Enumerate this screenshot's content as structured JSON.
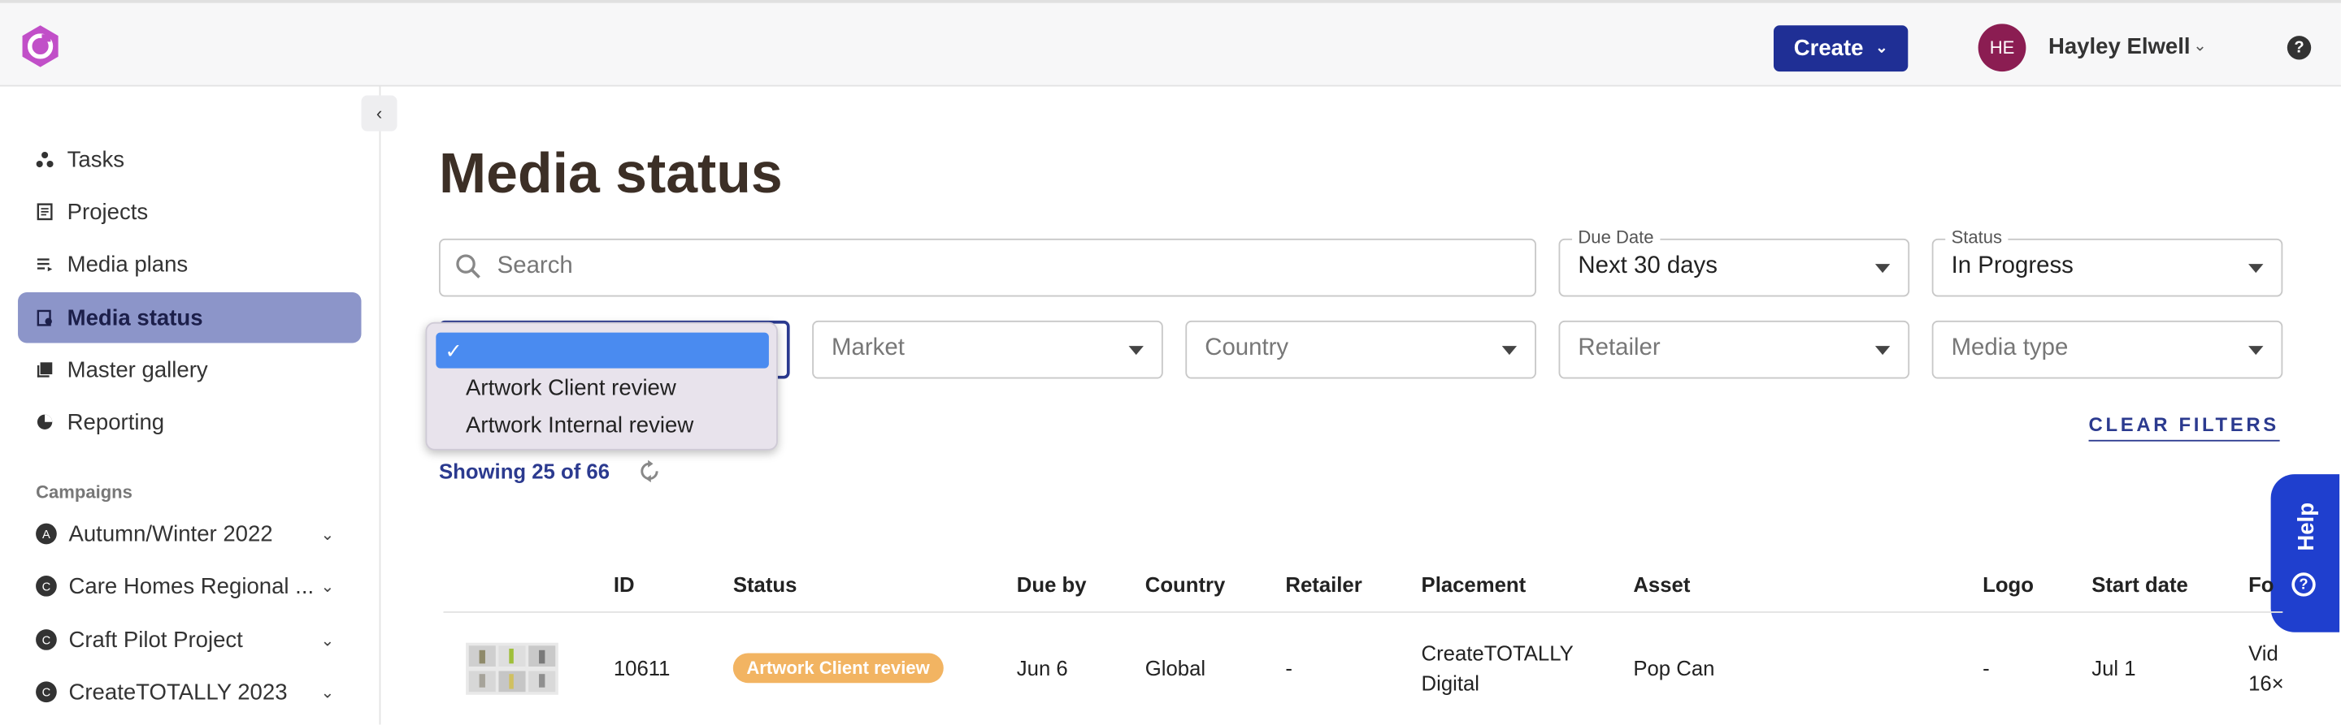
{
  "header": {
    "create_label": "Create",
    "user_initials": "HE",
    "user_name": "Hayley Elwell",
    "help_symbol": "?"
  },
  "sidebar": {
    "items": [
      {
        "label": "Tasks",
        "icon": "tasks-icon"
      },
      {
        "label": "Projects",
        "icon": "projects-icon"
      },
      {
        "label": "Media plans",
        "icon": "media-plans-icon"
      },
      {
        "label": "Media status",
        "icon": "media-status-icon",
        "active": true
      },
      {
        "label": "Master gallery",
        "icon": "gallery-icon"
      },
      {
        "label": "Reporting",
        "icon": "reporting-icon"
      }
    ],
    "campaigns_label": "Campaigns",
    "campaigns": [
      {
        "badge": "A",
        "label": "Autumn/Winter 2022"
      },
      {
        "badge": "C",
        "label": "Care Homes Regional ..."
      },
      {
        "badge": "C",
        "label": "Craft Pilot Project"
      },
      {
        "badge": "C",
        "label": "CreateTOTALLY 2023"
      }
    ]
  },
  "main": {
    "title": "Media status",
    "search_placeholder": "Search",
    "due_date": {
      "legend": "Due Date",
      "value": "Next 30 days"
    },
    "status": {
      "legend": "Status",
      "value": "In Progress"
    },
    "filters": {
      "market": "Market",
      "country": "Country",
      "retailer": "Retailer",
      "media_type": "Media type"
    },
    "dropdown": {
      "selected_mark": "✓",
      "options": [
        "Artwork Client review",
        "Artwork Internal review"
      ]
    },
    "clear_filters": "CLEAR FILTERS",
    "showing": "Showing 25 of 66",
    "help_tab": "Help"
  },
  "table": {
    "headers": [
      "ID",
      "Status",
      "Due by",
      "Country",
      "Retailer",
      "Placement",
      "Asset",
      "Logo",
      "Start date",
      "Fo"
    ],
    "rows": [
      {
        "id": "10611",
        "status": "Artwork Client review",
        "status_color": "#f2b462",
        "due_by": "Jun 6",
        "country": "Global",
        "retailer": "-",
        "placement_line1": "CreateTOTALLY",
        "placement_line2": "Digital",
        "asset": "Pop Can",
        "logo": "-",
        "start_date": "Jul 1",
        "format_line1": "Vid",
        "format_line2": "16×"
      }
    ]
  }
}
